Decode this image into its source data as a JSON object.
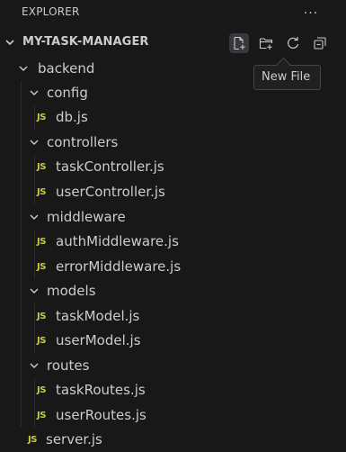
{
  "explorer": {
    "title": "EXPLORER",
    "more_label": "...",
    "project_name": "MY-TASK-MANAGER",
    "actions": [
      "new-file",
      "new-folder",
      "refresh",
      "collapse-all"
    ],
    "tooltip": "New File",
    "tree": {
      "backend": "backend",
      "config": "config",
      "db": "db.js",
      "controllers": "controllers",
      "taskController": "taskController.js",
      "userController": "userController.js",
      "middleware": "middleware",
      "authMiddleware": "authMiddleware.js",
      "errorMiddleware": "errorMiddleware.js",
      "models": "models",
      "taskModel": "taskModel.js",
      "userModel": "userModel.js",
      "routes": "routes",
      "taskRoutes": "taskRoutes.js",
      "userRoutes": "userRoutes.js",
      "server": "server.js"
    },
    "js_badge": "JS",
    "colors": {
      "background": "#181818",
      "text": "#cccccc",
      "js_icon": "#cbcb41",
      "tooltip_bg": "#202020",
      "tooltip_border": "#454545"
    }
  }
}
